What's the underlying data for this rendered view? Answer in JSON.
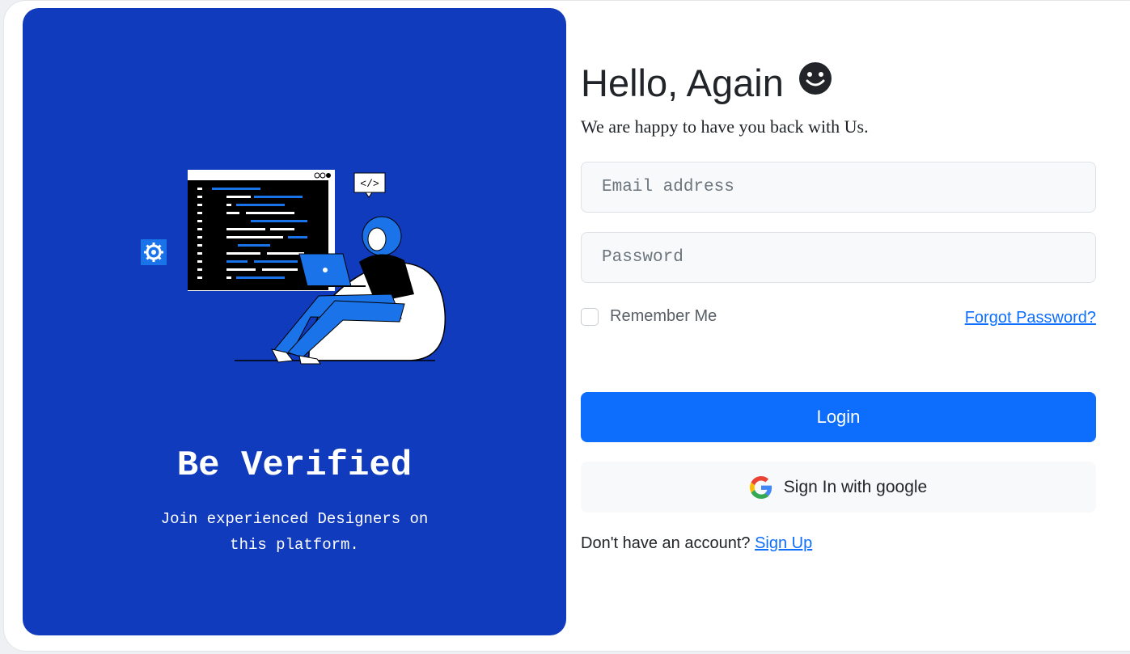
{
  "left": {
    "title": "Be Verified",
    "subtitle_line1": "Join experienced Designers on",
    "subtitle_line2": "this platform.",
    "illustration_code_tag": "</>"
  },
  "form": {
    "heading": "Hello, Again",
    "subtitle": "We are happy to have you back with Us.",
    "email_placeholder": "Email address",
    "password_placeholder": "Password",
    "remember_label": "Remember Me",
    "forgot_label": "Forgot Password?",
    "login_label": "Login",
    "google_label": "Sign In with google",
    "no_account_text": "Don't have an account? ",
    "signup_label": "Sign Up"
  },
  "colors": {
    "panel_blue": "#113bbd",
    "primary": "#0d6efd",
    "input_bg": "#f8f9fa"
  },
  "icons": [
    "smiley-icon",
    "gear-icon",
    "google-icon"
  ]
}
